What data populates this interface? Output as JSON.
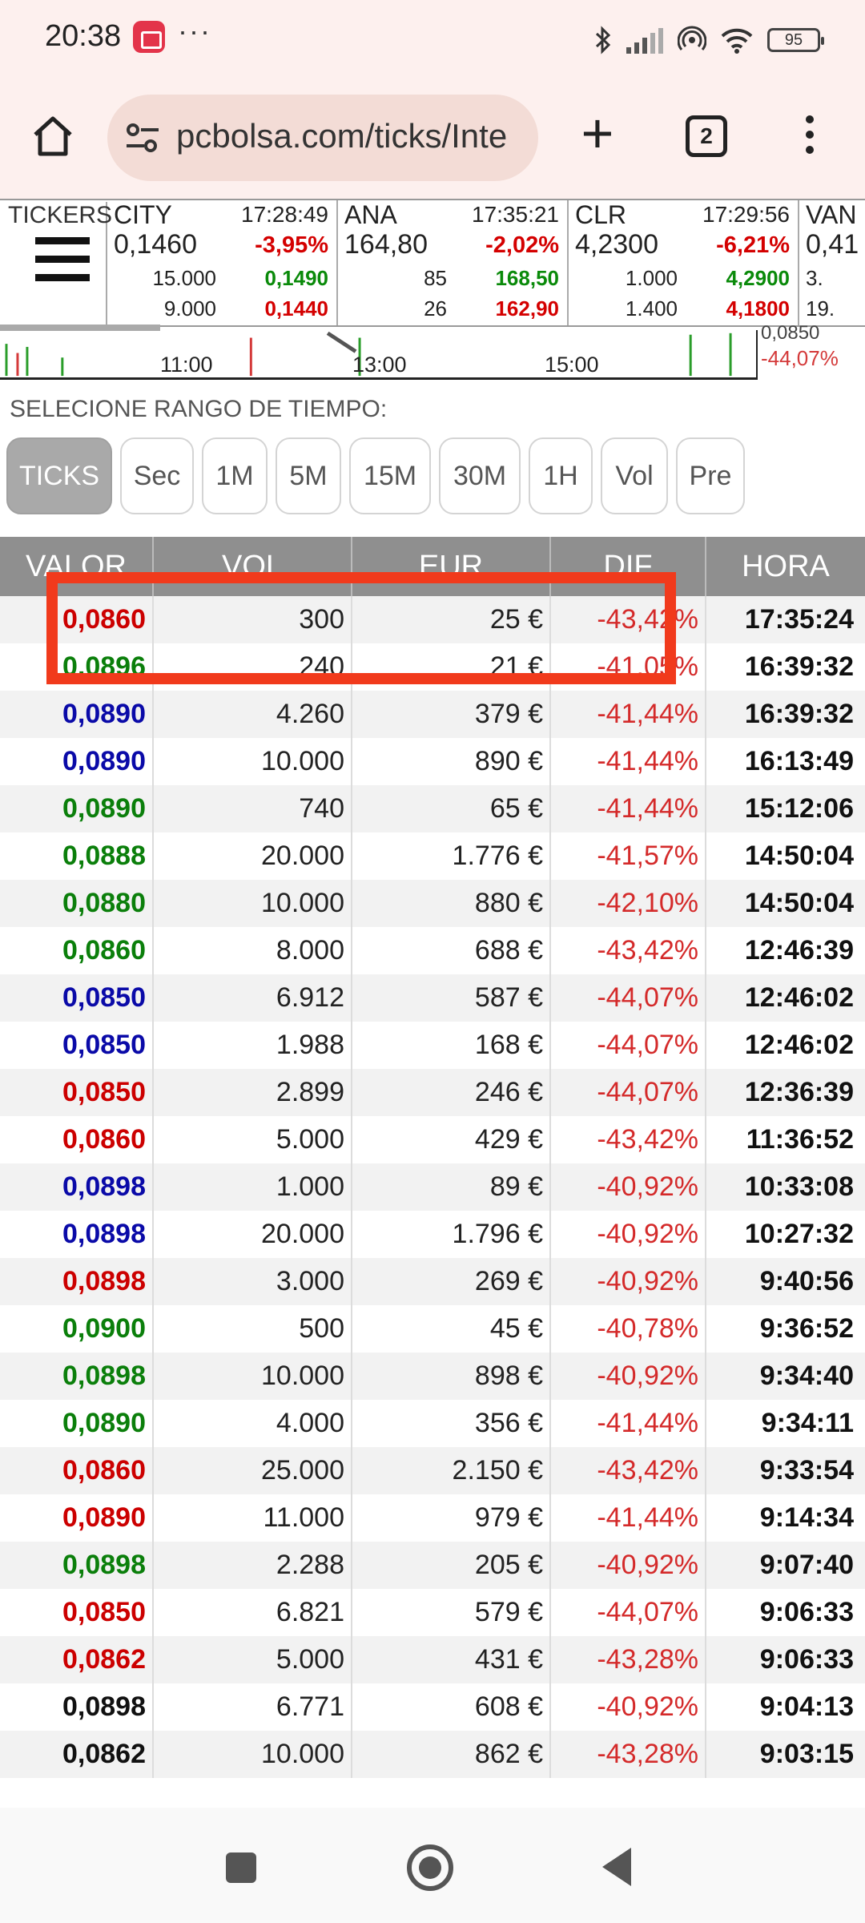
{
  "status_bar": {
    "time": "20:38",
    "dots": "···",
    "battery": "95",
    "icons": [
      "bluetooth-icon",
      "signal-icon",
      "hotspot-icon",
      "wifi-icon",
      "battery-icon"
    ]
  },
  "browser": {
    "url": "pcbolsa.com/ticks/Inte",
    "tab_count": "2",
    "plus": "+"
  },
  "tickers": {
    "label": "TICKERS",
    "cards": [
      {
        "name": "CITY",
        "time": "17:28:49",
        "price": "0,1460",
        "change": "-3,95%",
        "bid_vol": "15.000",
        "bid": "0,1490",
        "ask_vol": "9.000",
        "ask": "0,1440"
      },
      {
        "name": "ANA",
        "time": "17:35:21",
        "price": "164,80",
        "change": "-2,02%",
        "bid_vol": "85",
        "bid": "168,50",
        "ask_vol": "26",
        "ask": "162,90"
      },
      {
        "name": "CLR",
        "time": "17:29:56",
        "price": "4,2300",
        "change": "-6,21%",
        "bid_vol": "1.000",
        "bid": "4,2900",
        "ask_vol": "1.400",
        "ask": "4,1800"
      },
      {
        "name": "VAN",
        "time": "",
        "price": "0,41",
        "change": "",
        "bid_vol": "3.",
        "bid": "",
        "ask_vol": "19.",
        "ask": ""
      }
    ]
  },
  "mini_chart": {
    "x_labels": [
      "11:00",
      "13:00",
      "15:00"
    ],
    "price_top": "0,0850",
    "pct": "-44,07%"
  },
  "range": {
    "title": "SELECIONE RANGO DE TIEMPO:",
    "buttons": [
      "TICKS",
      "Sec",
      "1M",
      "5M",
      "15M",
      "30M",
      "1H",
      "Vol",
      "Pre"
    ],
    "active": "TICKS"
  },
  "table": {
    "headers": [
      "VALOR",
      "VOL",
      "EUR",
      "DIF",
      "HORA"
    ],
    "rows": [
      {
        "valor": "0,0860",
        "color": "red",
        "vol": "300",
        "eur": "25 €",
        "dif": "-43,42%",
        "hora": "17:35:24"
      },
      {
        "valor": "0,0896",
        "color": "green",
        "vol": "240",
        "eur": "21 €",
        "dif": "-41,05%",
        "hora": "16:39:32"
      },
      {
        "valor": "0,0890",
        "color": "blue",
        "vol": "4.260",
        "eur": "379 €",
        "dif": "-41,44%",
        "hora": "16:39:32"
      },
      {
        "valor": "0,0890",
        "color": "blue",
        "vol": "10.000",
        "eur": "890 €",
        "dif": "-41,44%",
        "hora": "16:13:49"
      },
      {
        "valor": "0,0890",
        "color": "green",
        "vol": "740",
        "eur": "65 €",
        "dif": "-41,44%",
        "hora": "15:12:06"
      },
      {
        "valor": "0,0888",
        "color": "green",
        "vol": "20.000",
        "eur": "1.776 €",
        "dif": "-41,57%",
        "hora": "14:50:04"
      },
      {
        "valor": "0,0880",
        "color": "green",
        "vol": "10.000",
        "eur": "880 €",
        "dif": "-42,10%",
        "hora": "14:50:04"
      },
      {
        "valor": "0,0860",
        "color": "green",
        "vol": "8.000",
        "eur": "688 €",
        "dif": "-43,42%",
        "hora": "12:46:39"
      },
      {
        "valor": "0,0850",
        "color": "blue",
        "vol": "6.912",
        "eur": "587 €",
        "dif": "-44,07%",
        "hora": "12:46:02"
      },
      {
        "valor": "0,0850",
        "color": "blue",
        "vol": "1.988",
        "eur": "168 €",
        "dif": "-44,07%",
        "hora": "12:46:02"
      },
      {
        "valor": "0,0850",
        "color": "red",
        "vol": "2.899",
        "eur": "246 €",
        "dif": "-44,07%",
        "hora": "12:36:39"
      },
      {
        "valor": "0,0860",
        "color": "red",
        "vol": "5.000",
        "eur": "429 €",
        "dif": "-43,42%",
        "hora": "11:36:52"
      },
      {
        "valor": "0,0898",
        "color": "blue",
        "vol": "1.000",
        "eur": "89 €",
        "dif": "-40,92%",
        "hora": "10:33:08"
      },
      {
        "valor": "0,0898",
        "color": "blue",
        "vol": "20.000",
        "eur": "1.796 €",
        "dif": "-40,92%",
        "hora": "10:27:32"
      },
      {
        "valor": "0,0898",
        "color": "red",
        "vol": "3.000",
        "eur": "269 €",
        "dif": "-40,92%",
        "hora": "9:40:56"
      },
      {
        "valor": "0,0900",
        "color": "green",
        "vol": "500",
        "eur": "45 €",
        "dif": "-40,78%",
        "hora": "9:36:52"
      },
      {
        "valor": "0,0898",
        "color": "green",
        "vol": "10.000",
        "eur": "898 €",
        "dif": "-40,92%",
        "hora": "9:34:40"
      },
      {
        "valor": "0,0890",
        "color": "green",
        "vol": "4.000",
        "eur": "356 €",
        "dif": "-41,44%",
        "hora": "9:34:11"
      },
      {
        "valor": "0,0860",
        "color": "red",
        "vol": "25.000",
        "eur": "2.150 €",
        "dif": "-43,42%",
        "hora": "9:33:54"
      },
      {
        "valor": "0,0890",
        "color": "red",
        "vol": "11.000",
        "eur": "979 €",
        "dif": "-41,44%",
        "hora": "9:14:34"
      },
      {
        "valor": "0,0898",
        "color": "green",
        "vol": "2.288",
        "eur": "205 €",
        "dif": "-40,92%",
        "hora": "9:07:40"
      },
      {
        "valor": "0,0850",
        "color": "red",
        "vol": "6.821",
        "eur": "579 €",
        "dif": "-44,07%",
        "hora": "9:06:33"
      },
      {
        "valor": "0,0862",
        "color": "red",
        "vol": "5.000",
        "eur": "431 €",
        "dif": "-43,28%",
        "hora": "9:06:33"
      },
      {
        "valor": "0,0898",
        "color": "black",
        "vol": "6.771",
        "eur": "608 €",
        "dif": "-40,92%",
        "hora": "9:04:13"
      },
      {
        "valor": "0,0862",
        "color": "black",
        "vol": "10.000",
        "eur": "862 €",
        "dif": "-43,28%",
        "hora": "9:03:15"
      }
    ]
  },
  "colors": {
    "highlight": "#f13a1c",
    "up": "#0b7f0b",
    "down": "#cc0000",
    "neutral": "#0a0aa8"
  }
}
